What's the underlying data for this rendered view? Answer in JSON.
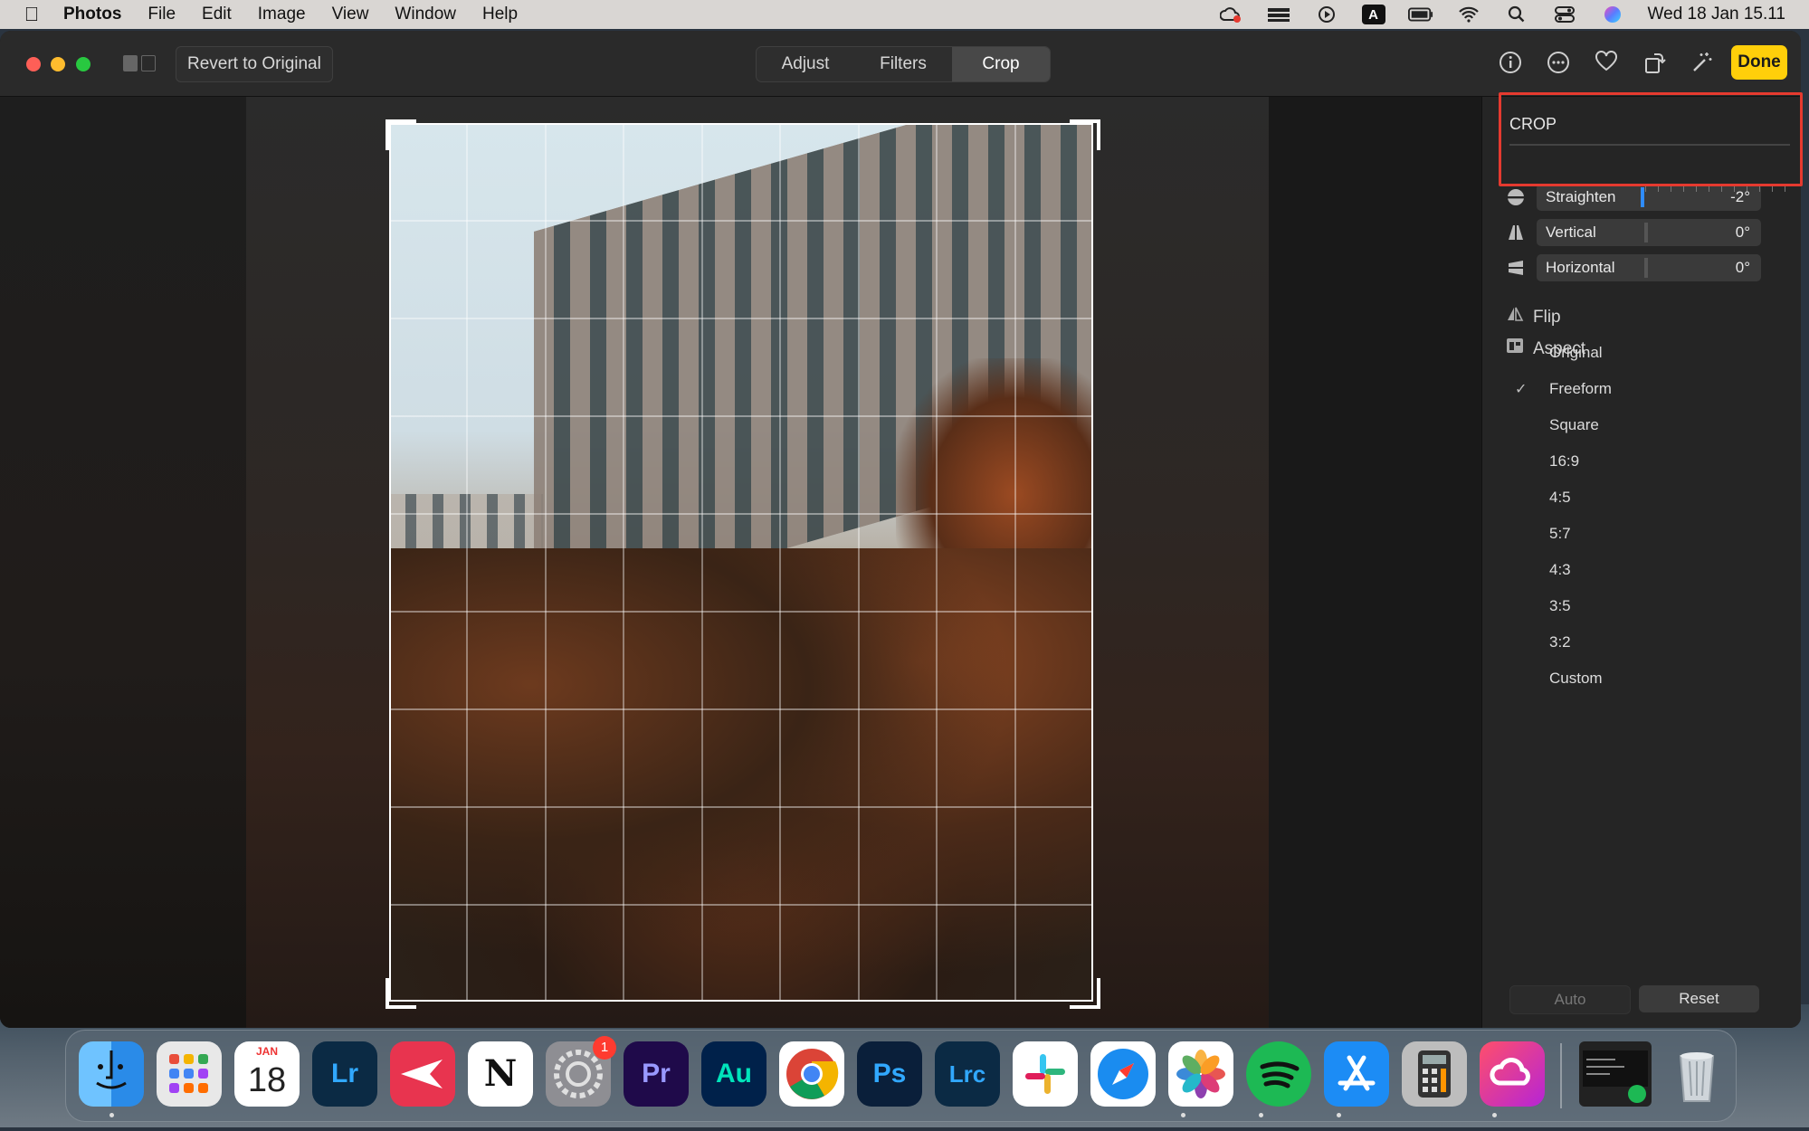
{
  "menubar": {
    "app": "Photos",
    "items": [
      "File",
      "Edit",
      "Image",
      "View",
      "Window",
      "Help"
    ],
    "status_a": "A",
    "clock": "Wed 18 Jan  15.11"
  },
  "toolbar": {
    "revert_label": "Revert to Original",
    "tabs": [
      {
        "label": "Adjust",
        "active": false
      },
      {
        "label": "Filters",
        "active": false
      },
      {
        "label": "Crop",
        "active": true
      }
    ],
    "icons": [
      "info-icon",
      "more-icon",
      "heart-icon",
      "rotate-icon",
      "magic-wand-icon"
    ],
    "done_label": "Done",
    "done_color": "#ffcf0a"
  },
  "sidebar": {
    "title": "CROP",
    "sliders": [
      {
        "label": "Straighten",
        "value": "-2°",
        "icon": "straighten-icon",
        "active": true
      },
      {
        "label": "Vertical",
        "value": "0°",
        "icon": "vertical-icon",
        "active": false
      },
      {
        "label": "Horizontal",
        "value": "0°",
        "icon": "horizontal-icon",
        "active": false
      }
    ],
    "flip_label": "Flip",
    "aspect_label": "Aspect",
    "aspect_options": [
      "Original",
      "Freeform",
      "Square",
      "16:9",
      "4:5",
      "5:7",
      "4:3",
      "3:5",
      "3:2",
      "Custom"
    ],
    "selected_aspect": "Freeform",
    "check_mark": "✓",
    "auto_label": "Auto",
    "reset_label": "Reset",
    "highlight_color": "#e53a2f"
  },
  "dock": {
    "calendar_month": "JAN",
    "calendar_day": "18",
    "settings_badge": "1",
    "apps": [
      {
        "name": "finder-icon",
        "label": "",
        "color": "#3aa0f2"
      },
      {
        "name": "launchpad-icon",
        "label": "",
        "color": "#e8e8e8"
      },
      {
        "name": "calendar-icon",
        "label": "",
        "color": "#ffffff"
      },
      {
        "name": "lightroom-icon",
        "label": "Lr",
        "color": "#0b2a44"
      },
      {
        "name": "spark-icon",
        "label": "",
        "color": "#e8344f"
      },
      {
        "name": "notion-icon",
        "label": "N",
        "color": "#ffffff"
      },
      {
        "name": "system-settings-icon",
        "label": "",
        "color": "#8e8e93"
      },
      {
        "name": "premiere-icon",
        "label": "Pr",
        "color": "#1f0a4a"
      },
      {
        "name": "audition-icon",
        "label": "Au",
        "color": "#00214a"
      },
      {
        "name": "chrome-icon",
        "label": "",
        "color": "#ffffff"
      },
      {
        "name": "photoshop-icon",
        "label": "Ps",
        "color": "#0a1f3a"
      },
      {
        "name": "lightroom-classic-icon",
        "label": "Lrc",
        "color": "#0b2a44"
      },
      {
        "name": "slack-icon",
        "label": "",
        "color": "#ffffff"
      },
      {
        "name": "safari-icon",
        "label": "",
        "color": "#ffffff"
      },
      {
        "name": "photos-icon",
        "label": "",
        "color": "#ffffff"
      },
      {
        "name": "spotify-icon",
        "label": "",
        "color": "#1db954"
      },
      {
        "name": "app-store-icon",
        "label": "",
        "color": "#1c8cf5"
      },
      {
        "name": "calculator-icon",
        "label": "",
        "color": "#bdbdbd"
      },
      {
        "name": "creative-cloud-icon",
        "label": "",
        "color": "#e6345a"
      },
      {
        "name": "music-widget-icon",
        "label": "",
        "color": "#222222"
      },
      {
        "name": "trash-icon",
        "label": "",
        "color": "#cfd5da"
      }
    ]
  }
}
